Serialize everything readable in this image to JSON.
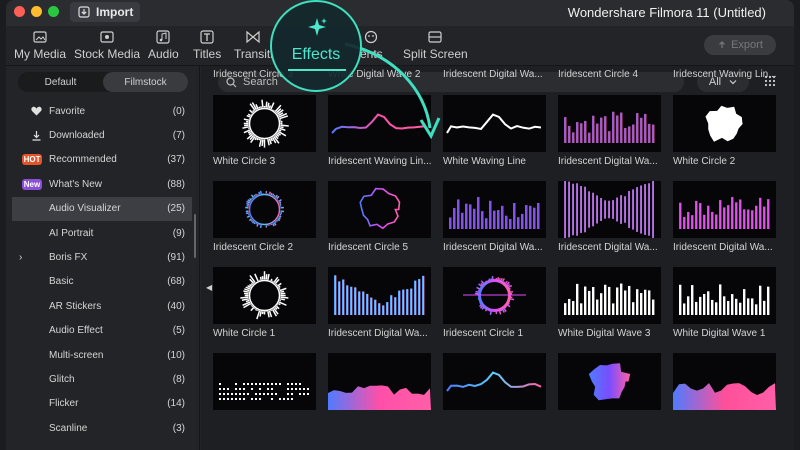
{
  "app": {
    "title": "Wondershare Filmora 11 (Untitled)",
    "import_label": "Import",
    "export_label": "Export"
  },
  "toolbar": {
    "items": [
      {
        "label": "My Media",
        "icon": "folder-icon"
      },
      {
        "label": "Stock Media",
        "icon": "stock-media-icon"
      },
      {
        "label": "Audio",
        "icon": "music-note-icon"
      },
      {
        "label": "Titles",
        "icon": "titles-icon"
      },
      {
        "label": "Transiti",
        "icon": "transitions-icon"
      },
      {
        "label": "ents",
        "icon": "elements-icon"
      },
      {
        "label": "Split Screen",
        "icon": "split-screen-icon"
      }
    ],
    "effects_label": "Effects",
    "highlight_color": "#3ee0c0"
  },
  "sidebar": {
    "tabs": [
      "Default",
      "Filmstock"
    ],
    "active_tab": "Filmstock",
    "categories": [
      {
        "label": "Favorite",
        "count": "(0)",
        "icon": "heart-icon"
      },
      {
        "label": "Downloaded",
        "count": "(7)",
        "icon": "download-icon"
      },
      {
        "label": "Recommended",
        "count": "(37)",
        "icon": "hot-badge",
        "badge": "HOT"
      },
      {
        "label": "What's New",
        "count": "(88)",
        "icon": "new-badge",
        "badge": "New"
      },
      {
        "label": "Audio Visualizer",
        "count": "(25)",
        "active": true
      },
      {
        "label": "AI Portrait",
        "count": "(9)"
      },
      {
        "label": "Boris FX",
        "count": "(91)",
        "expandable": true
      },
      {
        "label": "Basic",
        "count": "(68)"
      },
      {
        "label": "AR Stickers",
        "count": "(40)"
      },
      {
        "label": "Audio Effect",
        "count": "(5)"
      },
      {
        "label": "Multi-screen",
        "count": "(10)"
      },
      {
        "label": "Glitch",
        "count": "(8)"
      },
      {
        "label": "Flicker",
        "count": "(14)"
      },
      {
        "label": "Scanline",
        "count": "(3)"
      }
    ]
  },
  "content": {
    "search_placeholder": "Search",
    "filter_value": "All",
    "top_row_labels": [
      "Iridescent Circle 3",
      "White  Digital Wave 2",
      "Iridescent Digital Wa...",
      "Iridescent Circle 4",
      "Iridescent Waving Lin..."
    ],
    "rows": [
      [
        {
          "label": "White Circle 3",
          "viz": "ring-spiky",
          "color": "#ffffff"
        },
        {
          "label": "Iridescent Waving Lin...",
          "viz": "wave-line",
          "color": "#ff4fa8"
        },
        {
          "label": "White Waving Line",
          "viz": "wave-line",
          "color": "#ffffff"
        },
        {
          "label": "Iridescent Digital Wa...",
          "viz": "bars",
          "color": "#ff2e88"
        },
        {
          "label": "White Circle 2",
          "viz": "blob",
          "color": "#ffffff"
        }
      ],
      [
        {
          "label": "Iridescent Circle 2",
          "viz": "ring",
          "color": "#4fc3ff"
        },
        {
          "label": "Iridescent Circle 5",
          "viz": "blob-outline",
          "color": "#d64dff"
        },
        {
          "label": "Iridescent Digital Wa...",
          "viz": "bars",
          "color": "#5a4dff"
        },
        {
          "label": "Iridescent Digital Wa...",
          "viz": "bars-mirror",
          "color": "#ff4fa8"
        },
        {
          "label": "Iridescent Digital Wa...",
          "viz": "bars",
          "color": "#d64dff"
        }
      ],
      [
        {
          "label": "White Circle 1",
          "viz": "ring-spiky",
          "color": "#ffffff"
        },
        {
          "label": "Iridescent Digital Wa...",
          "viz": "bars-curve",
          "color": "#4fe3ff"
        },
        {
          "label": "Iridescent Circle 1",
          "viz": "ring-glow",
          "color": "#e04dff"
        },
        {
          "label": "White Digital Wave 3",
          "viz": "bars",
          "color": "#ffffff"
        },
        {
          "label": "White Digital Wave 1",
          "viz": "bars",
          "color": "#ffffff"
        }
      ],
      [
        {
          "label": "",
          "viz": "dots",
          "color": "#ffffff"
        },
        {
          "label": "",
          "viz": "mountain",
          "color": "#ff4fa8"
        },
        {
          "label": "",
          "viz": "wave-line",
          "color": "#5ad1ff"
        },
        {
          "label": "",
          "viz": "blob",
          "color": "#7a4dff"
        },
        {
          "label": "",
          "viz": "mountain",
          "color": "#ff4f9a"
        }
      ]
    ]
  }
}
